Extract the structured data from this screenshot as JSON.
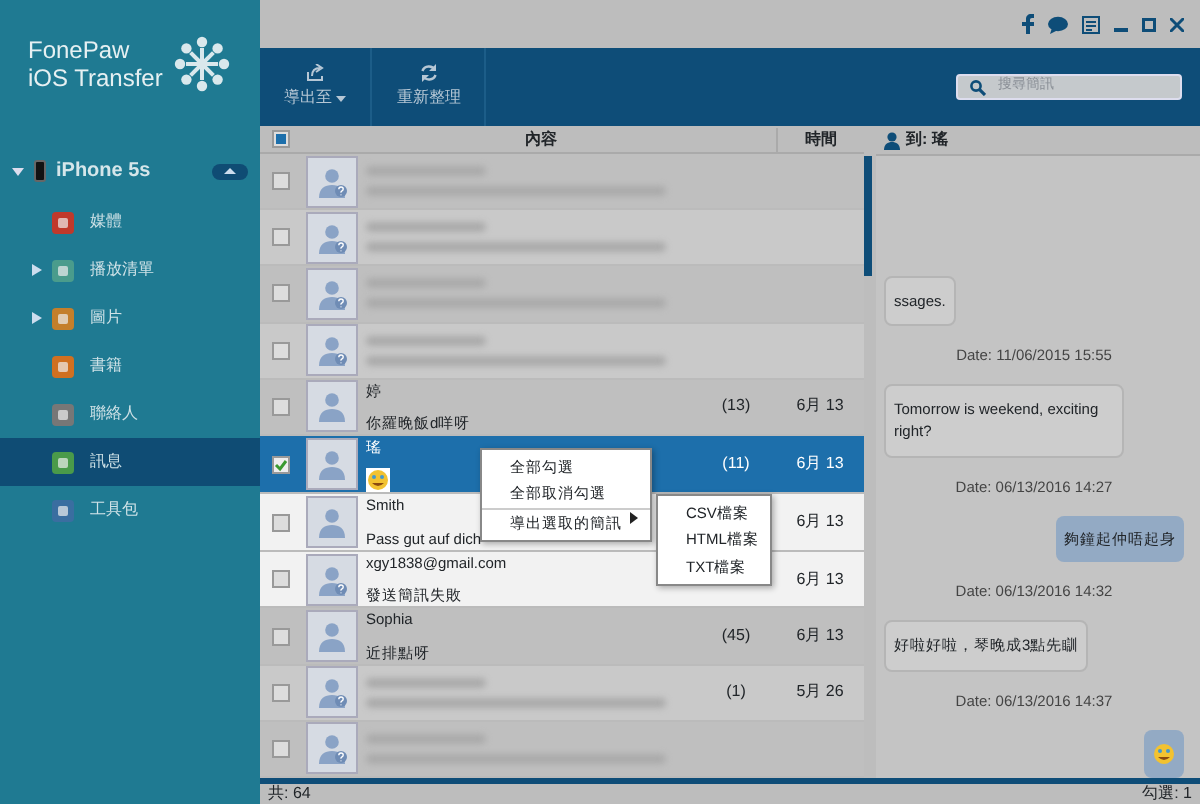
{
  "app": {
    "title_line_1": "FonePaw",
    "title_line_2": "iOS Transfer"
  },
  "device": {
    "name": "iPhone 5s",
    "expanded": true
  },
  "sidebar": {
    "items": [
      {
        "label": "媒體",
        "expandable": false,
        "selected": false
      },
      {
        "label": "播放清單",
        "expandable": true,
        "selected": false
      },
      {
        "label": "圖片",
        "expandable": true,
        "selected": false
      },
      {
        "label": "書籍",
        "expandable": false,
        "selected": false
      },
      {
        "label": "聯絡人",
        "expandable": false,
        "selected": false
      },
      {
        "label": "訊息",
        "expandable": false,
        "selected": true
      },
      {
        "label": "工具包",
        "expandable": false,
        "selected": false
      }
    ]
  },
  "toolbar": {
    "buttons": [
      {
        "label": "導出至",
        "dropdown": true
      },
      {
        "label": "重新整理",
        "dropdown": false
      }
    ],
    "search": {
      "placeholder": "搜尋簡訊"
    }
  },
  "table": {
    "all_checked": true,
    "columns": [
      "內容",
      "時間"
    ],
    "rows": [
      {
        "kind": "blurred",
        "checked": false,
        "selected": false,
        "spotlight": false,
        "unknown": true
      },
      {
        "kind": "blurred",
        "checked": false,
        "selected": false,
        "spotlight": false,
        "unknown": true
      },
      {
        "kind": "blurred",
        "checked": false,
        "selected": false,
        "spotlight": false,
        "unknown": true
      },
      {
        "kind": "blurred",
        "checked": false,
        "selected": false,
        "spotlight": false,
        "unknown": true
      },
      {
        "kind": "contact",
        "name": "婷",
        "preview": "你羅晚飯d咩呀",
        "count": "(13)",
        "time": "6月 13",
        "checked": false,
        "selected": false,
        "spotlight": false,
        "unknown": false
      },
      {
        "kind": "contact",
        "name": "瑤",
        "preview_emoji": true,
        "count": "(11)",
        "time": "6月 13",
        "checked": true,
        "selected": true,
        "spotlight": true,
        "unknown": false
      },
      {
        "kind": "contact",
        "name": "Smith",
        "preview": "Pass gut auf dich",
        "time": "6月 13",
        "checked": false,
        "selected": false,
        "spotlight": true,
        "unknown": false
      },
      {
        "kind": "contact",
        "name": "xgy1838@gmail.com",
        "preview": "發送簡訊失敗",
        "time": "6月 13",
        "checked": false,
        "selected": false,
        "spotlight": true,
        "unknown": true
      },
      {
        "kind": "contact",
        "name": "Sophia",
        "preview": "近排點呀",
        "count": "(45)",
        "time": "6月 13",
        "checked": false,
        "selected": false,
        "spotlight": false,
        "unknown": false
      },
      {
        "kind": "blurred",
        "count": "(1)",
        "time": "5月 26",
        "checked": false,
        "selected": false,
        "spotlight": false,
        "unknown": true
      },
      {
        "kind": "blurred",
        "checked": false,
        "selected": false,
        "spotlight": false,
        "unknown": true
      }
    ]
  },
  "context_menu": {
    "items": [
      "全部勾選",
      "全部取消勾選",
      "導出選取的簡訊"
    ],
    "submenu": [
      "CSV檔案",
      "HTML檔案",
      "TXT檔案"
    ]
  },
  "chat": {
    "recipient": "到: 瑤",
    "messages": [
      {
        "kind": "received",
        "text": "ssages."
      },
      {
        "kind": "date",
        "text": "Date: 11/06/2015 15:55"
      },
      {
        "kind": "received",
        "text": "Tomorrow is weekend, exciting right?"
      },
      {
        "kind": "date",
        "text": "Date: 06/13/2016 14:27"
      },
      {
        "kind": "sent",
        "text": "夠鐘起仲唔起身"
      },
      {
        "kind": "date",
        "text": "Date: 06/13/2016 14:32"
      },
      {
        "kind": "received",
        "text": "好啦好啦，琴晚成3點先瞓"
      },
      {
        "kind": "date",
        "text": "Date: 06/13/2016 14:37"
      },
      {
        "kind": "sent_emoji"
      }
    ]
  },
  "status_bar": {
    "total": "共: 64",
    "checked": "勾選: 1"
  }
}
